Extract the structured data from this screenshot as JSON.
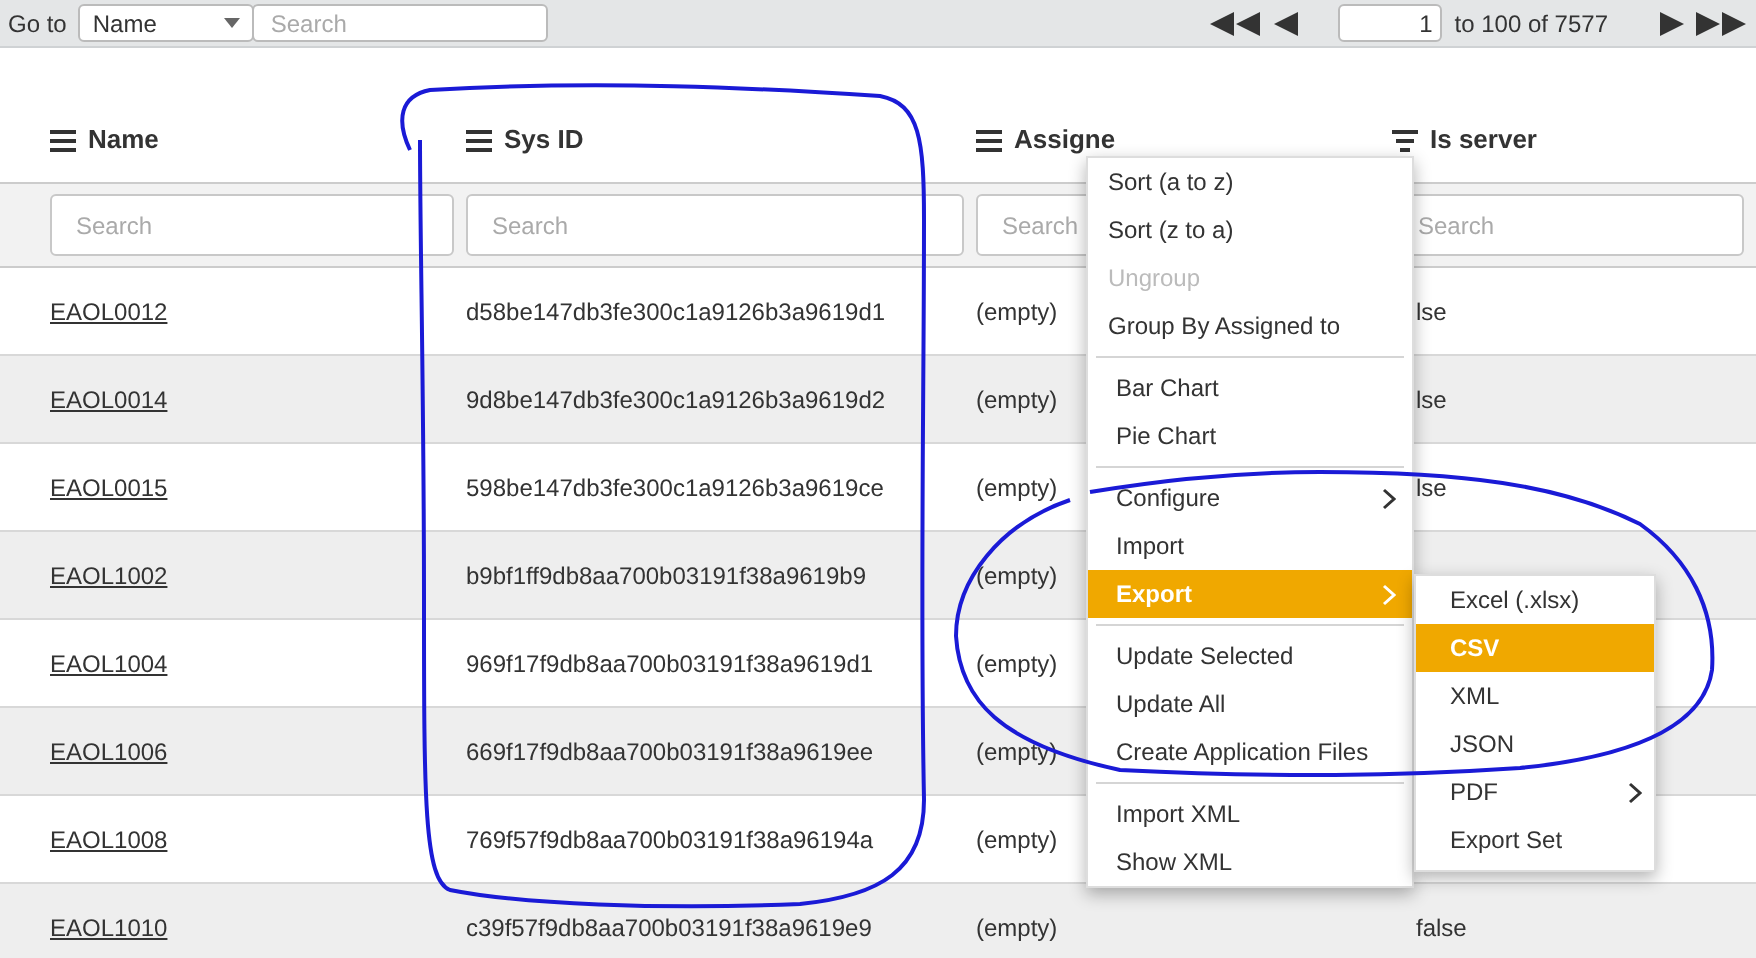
{
  "toolbar": {
    "goto_label": "Go to",
    "field_select": "Name",
    "search": {
      "placeholder": "Search"
    },
    "page": "1",
    "range": "to 100 of 7577"
  },
  "table": {
    "columns": [
      {
        "label": "Name"
      },
      {
        "label": "Sys ID"
      },
      {
        "label": "Assigne"
      },
      {
        "label": "Is server"
      }
    ],
    "filters": [
      {
        "placeholder": "Search"
      },
      {
        "placeholder": "Search"
      },
      {
        "placeholder": "Search"
      },
      {
        "placeholder": "Search"
      }
    ],
    "rows": [
      {
        "name": "EAOL0012",
        "sys_id": "d58be147db3fe300c1a9126b3a9619d1",
        "assigned_to": "(empty)",
        "is_server": "lse"
      },
      {
        "name": "EAOL0014",
        "sys_id": "9d8be147db3fe300c1a9126b3a9619d2",
        "assigned_to": "(empty)",
        "is_server": "lse"
      },
      {
        "name": "EAOL0015",
        "sys_id": "598be147db3fe300c1a9126b3a9619ce",
        "assigned_to": "(empty)",
        "is_server": "lse"
      },
      {
        "name": "EAOL1002",
        "sys_id": "b9bf1ff9db8aa700b03191f38a9619b9",
        "assigned_to": "(empty)"
      },
      {
        "name": "EAOL1004",
        "sys_id": "969f17f9db8aa700b03191f38a9619d1",
        "assigned_to": "(empty)"
      },
      {
        "name": "EAOL1006",
        "sys_id": "669f17f9db8aa700b03191f38a9619ee",
        "assigned_to": "(empty)"
      },
      {
        "name": "EAOL1008",
        "sys_id": "769f57f9db8aa700b03191f38a96194a",
        "assigned_to": "(empty)"
      },
      {
        "name": "EAOL1010",
        "sys_id": "c39f57f9db8aa700b03191f38a9619e9",
        "assigned_to": "(empty)",
        "is_server": "false"
      }
    ]
  },
  "context_menu": {
    "groups": [
      [
        {
          "label": "Sort (a to z)",
          "disabled": false,
          "selected": false,
          "submenu": false
        },
        {
          "label": "Sort (z to a)",
          "disabled": false,
          "selected": false,
          "submenu": false
        },
        {
          "label": "Ungroup",
          "disabled": true,
          "selected": false,
          "submenu": false
        },
        {
          "label": "Group By Assigned to",
          "disabled": false,
          "selected": false,
          "submenu": false
        }
      ],
      [
        {
          "label": "Bar Chart",
          "disabled": false,
          "selected": false,
          "submenu": false
        },
        {
          "label": "Pie Chart",
          "disabled": false,
          "selected": false,
          "submenu": false
        }
      ],
      [
        {
          "label": "Configure",
          "disabled": false,
          "selected": false,
          "submenu": true
        },
        {
          "label": "Import",
          "disabled": false,
          "selected": false,
          "submenu": false
        },
        {
          "label": "Export",
          "disabled": false,
          "selected": true,
          "submenu": true
        }
      ],
      [
        {
          "label": "Update Selected",
          "disabled": false,
          "selected": false,
          "submenu": false
        },
        {
          "label": "Update All",
          "disabled": false,
          "selected": false,
          "submenu": false
        },
        {
          "label": "Create Application Files",
          "disabled": false,
          "selected": false,
          "submenu": false
        }
      ],
      [
        {
          "label": "Import XML",
          "disabled": false,
          "selected": false,
          "submenu": false
        },
        {
          "label": "Show XML",
          "disabled": false,
          "selected": false,
          "submenu": false
        }
      ]
    ]
  },
  "export_submenu": {
    "items": [
      {
        "label": "Excel (.xlsx)",
        "selected": false,
        "submenu": false
      },
      {
        "label": "CSV",
        "selected": true,
        "submenu": false
      },
      {
        "label": "XML",
        "selected": false,
        "submenu": false
      },
      {
        "label": "JSON",
        "selected": false,
        "submenu": false
      },
      {
        "label": "PDF",
        "selected": false,
        "submenu": true
      },
      {
        "label": "Export Set",
        "selected": false,
        "submenu": false
      }
    ]
  }
}
